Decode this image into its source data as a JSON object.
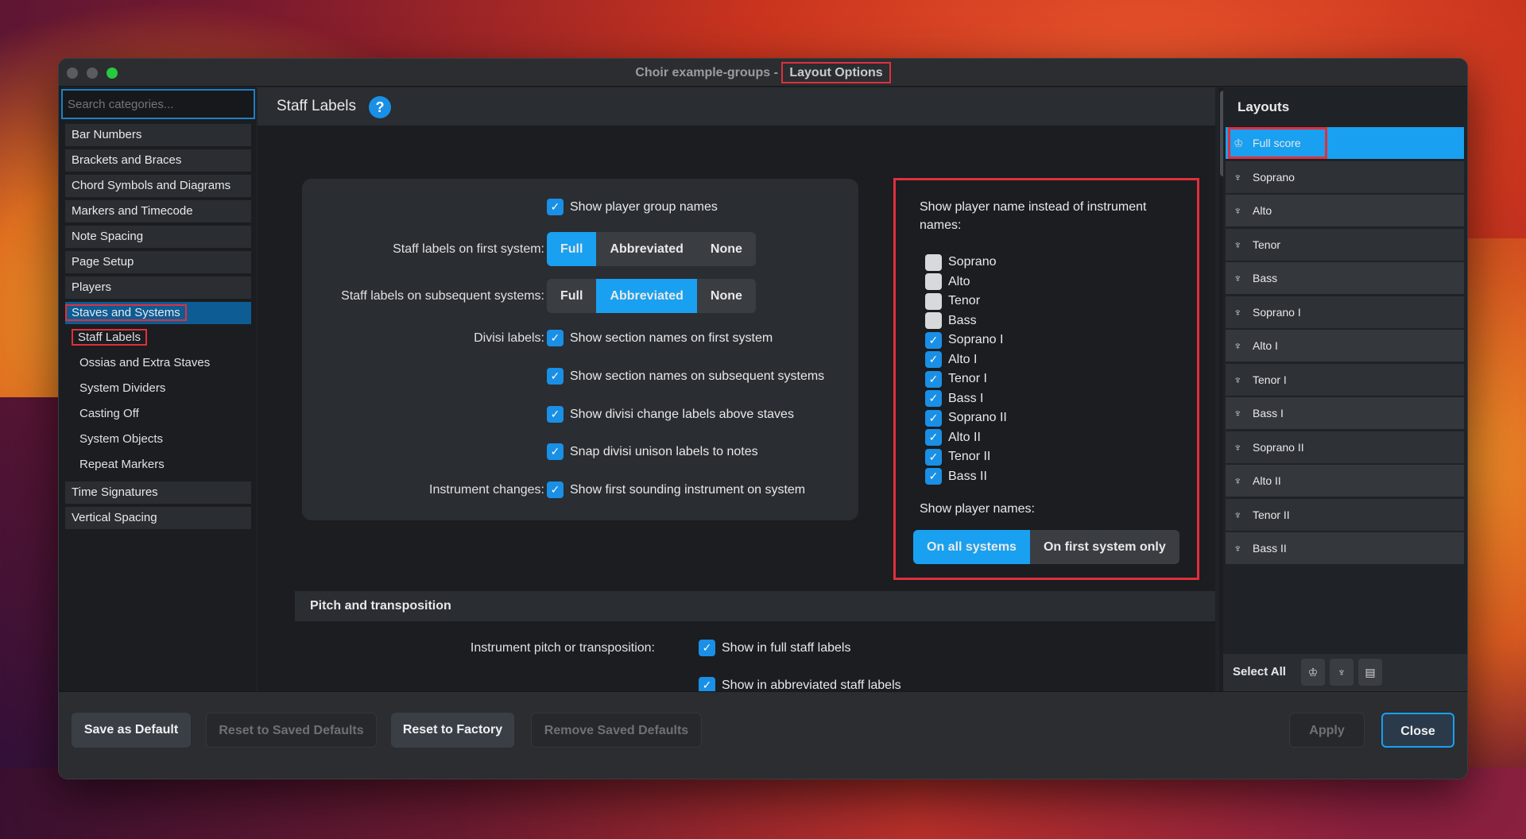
{
  "window": {
    "title_prefix": "Choir example-groups - ",
    "title_highlight": "Layout Options"
  },
  "search": {
    "placeholder": "Search categories..."
  },
  "categories": [
    "Bar Numbers",
    "Brackets and Braces",
    "Chord Symbols and Diagrams",
    "Markers and Timecode",
    "Note Spacing",
    "Page Setup",
    "Players",
    "Staves and Systems",
    "Time Signatures",
    "Vertical Spacing"
  ],
  "subcategories": [
    "Staff Labels",
    "Ossias and Extra Staves",
    "System Dividers",
    "Casting Off",
    "System Objects",
    "Repeat Markers"
  ],
  "main": {
    "title": "Staff Labels",
    "help_icon": "?",
    "show_group_names": "Show player group names",
    "first_system_label": "Staff labels on first system:",
    "subsequent_label": "Staff labels on subsequent systems:",
    "seg_options": [
      "Full",
      "Abbreviated",
      "None"
    ],
    "first_selected": "Full",
    "subsequent_selected": "Abbreviated",
    "divisi_label": "Divisi labels:",
    "divisi_opts": [
      "Show section names on first system",
      "Show section names on subsequent systems",
      "Show divisi change labels above staves",
      "Snap divisi unison labels to notes"
    ],
    "instr_changes_label": "Instrument changes:",
    "instr_changes_opt": "Show first sounding instrument on system",
    "player_name_title": "Show player name instead of instrument names:",
    "player_names": [
      {
        "name": "Soprano",
        "checked": false
      },
      {
        "name": "Alto",
        "checked": false
      },
      {
        "name": "Tenor",
        "checked": false
      },
      {
        "name": "Bass",
        "checked": false
      },
      {
        "name": "Soprano I",
        "checked": true
      },
      {
        "name": "Alto I",
        "checked": true
      },
      {
        "name": "Tenor I",
        "checked": true
      },
      {
        "name": "Bass I",
        "checked": true
      },
      {
        "name": "Soprano II",
        "checked": true
      },
      {
        "name": "Alto II",
        "checked": true
      },
      {
        "name": "Tenor II",
        "checked": true
      },
      {
        "name": "Bass II",
        "checked": true
      }
    ],
    "show_player_names_label": "Show player names:",
    "show_player_options": [
      "On all systems",
      "On first system only"
    ],
    "pitch_section": "Pitch and transposition",
    "pitch_label": "Instrument pitch or transposition:",
    "pitch_opts": [
      "Show in full staff labels",
      "Show in abbreviated staff labels"
    ]
  },
  "layouts": {
    "title": "Layouts",
    "items": [
      "Full score",
      "Soprano",
      "Alto",
      "Tenor",
      "Bass",
      "Soprano I",
      "Alto I",
      "Tenor I",
      "Bass I",
      "Soprano II",
      "Alto II",
      "Tenor II",
      "Bass II"
    ],
    "select_all": "Select All"
  },
  "footer": {
    "save_default": "Save as Default",
    "reset_saved": "Reset to Saved Defaults",
    "reset_factory": "Reset to Factory",
    "remove_saved": "Remove Saved Defaults",
    "apply": "Apply",
    "close": "Close"
  },
  "colors": {
    "accent": "#19a0f0",
    "highlight": "#e0303c",
    "active_category": "#0d5c94"
  }
}
